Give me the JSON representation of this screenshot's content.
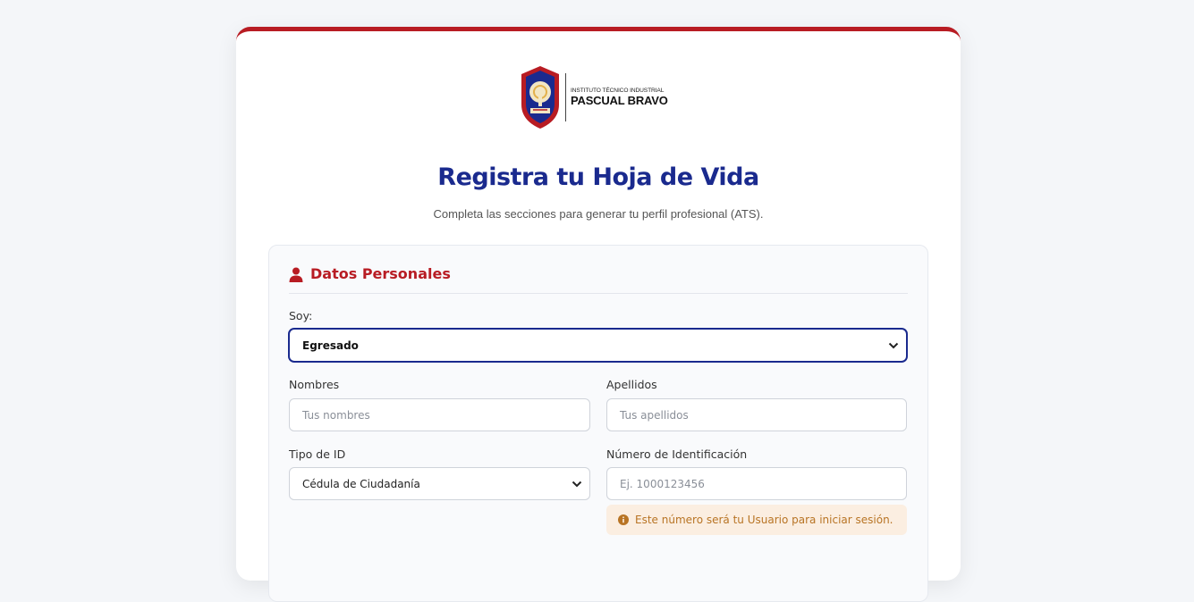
{
  "brand": {
    "line1": "INSTITUTO TÉCNICO INDUSTRIAL",
    "line2": "PASCUAL BRAVO",
    "colors": {
      "red": "#b81c23",
      "navy": "#1a2a8e",
      "gold": "#e3b04b"
    }
  },
  "header": {
    "title": "Registra tu Hoja de Vida",
    "subtitle": "Completa las secciones para generar tu perfil profesional (ATS)."
  },
  "personal": {
    "section_title": "Datos Personales",
    "section_icon": "user-icon",
    "soy": {
      "label": "Soy:",
      "value": "Egresado"
    },
    "nombres": {
      "label": "Nombres",
      "placeholder": "Tus nombres"
    },
    "apellidos": {
      "label": "Apellidos",
      "placeholder": "Tus apellidos"
    },
    "tipo_id": {
      "label": "Tipo de ID",
      "value": "Cédula de Ciudadanía"
    },
    "numero_id": {
      "label": "Número de Identificación",
      "placeholder": "Ej. 1000123456",
      "notice": "Este número será tu Usuario para iniciar sesión.",
      "notice_icon": "info-icon"
    }
  }
}
